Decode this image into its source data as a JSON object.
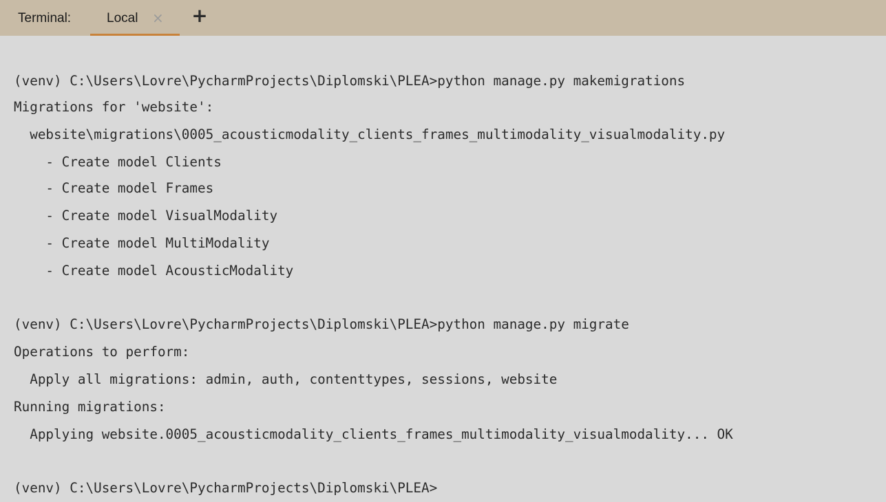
{
  "tabbar": {
    "title": "Terminal:",
    "tab_label": "Local",
    "close_glyph": "×",
    "new_tab_glyph": "+",
    "accent_color": "#c8823a",
    "background_color": "#c8bba6"
  },
  "terminal": {
    "background_color": "#d9d9d9",
    "lines": [
      "(venv) C:\\Users\\Lovre\\PycharmProjects\\Diplomski\\PLEA>python manage.py makemigrations",
      "Migrations for 'website':",
      "  website\\migrations\\0005_acousticmodality_clients_frames_multimodality_visualmodality.py",
      "    - Create model Clients",
      "    - Create model Frames",
      "    - Create model VisualModality",
      "    - Create model MultiModality",
      "    - Create model AcousticModality",
      "(venv) C:\\Users\\Lovre\\PycharmProjects\\Diplomski\\PLEA>python manage.py migrate",
      "Operations to perform:",
      "  Apply all migrations: admin, auth, contenttypes, sessions, website",
      "Running migrations:",
      "  Applying website.0005_acousticmodality_clients_frames_multimodality_visualmodality... OK",
      "(venv) C:\\Users\\Lovre\\PycharmProjects\\Diplomski\\PLEA>"
    ]
  }
}
